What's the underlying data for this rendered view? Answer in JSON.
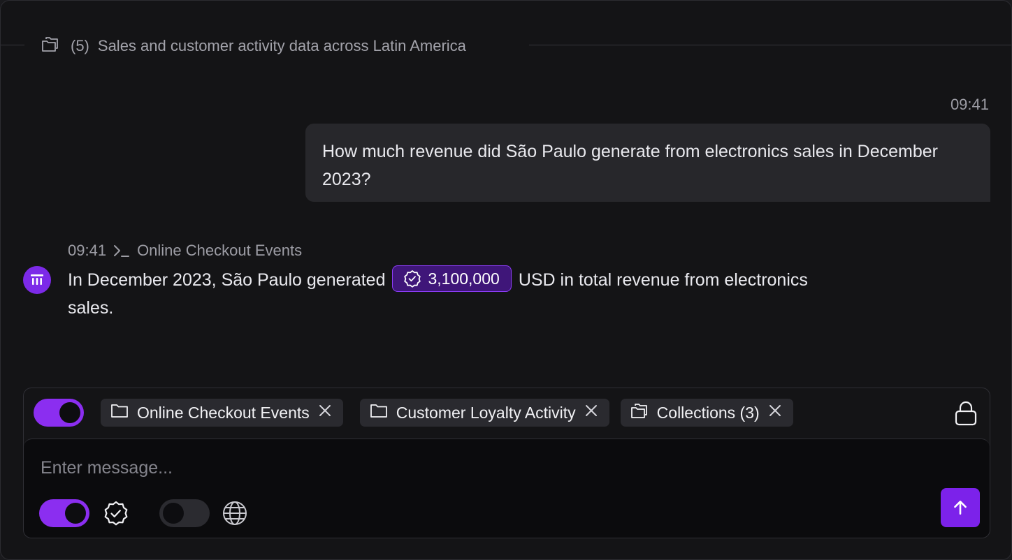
{
  "context": {
    "count": "(5)",
    "title": "Sales and customer activity data across Latin America"
  },
  "user_message": {
    "time": "09:41",
    "text": "How much revenue did São Paulo generate from electronics sales in December 2023?"
  },
  "assistant_message": {
    "time": "09:41",
    "source": "Online Checkout Events",
    "text_before": "In December 2023, São Paulo generated",
    "value": "3,100,000",
    "text_after": "USD in total revenue from electronics sales."
  },
  "composer": {
    "collections_toggle_on": true,
    "chips": [
      {
        "label": "Online Checkout Events",
        "icon": "folder-icon"
      },
      {
        "label": "Customer Loyalty Activity",
        "icon": "folder-icon"
      },
      {
        "label": "Collections (3)",
        "icon": "folders-icon"
      }
    ],
    "placeholder": "Enter message...",
    "verified_toggle_on": true,
    "web_toggle_on": false
  },
  "colors": {
    "accent": "#8b2ef0",
    "background": "#141416",
    "bubble": "#27272b",
    "pill": "#3f1679"
  }
}
